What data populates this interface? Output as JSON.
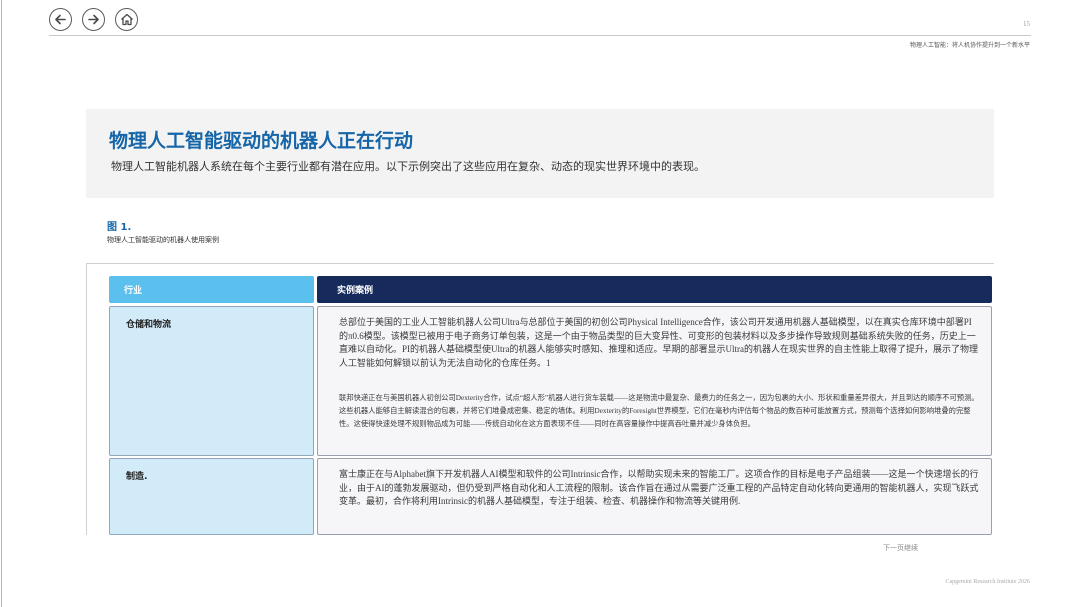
{
  "nav": {
    "back_icon": "arrow-left-icon",
    "forward_icon": "arrow-right-icon",
    "home_icon": "home-icon"
  },
  "header": {
    "page_number": "15",
    "doc_title": "物理人工智能：将人机协作提升到一个新水平"
  },
  "intro": {
    "title": "物理人工智能驱动的机器人正在行动",
    "text": "物理人工智能机器人系统在每个主要行业都有潜在应用。以下示例突出了这些应用在复杂、动态的现实世界环境中的表现。"
  },
  "figure": {
    "label": "图 1.",
    "caption": "物理人工智能驱动的机器人使用案例"
  },
  "table": {
    "col_industry": "行业",
    "col_cases": "实例案例",
    "rows": [
      {
        "industry": "仓储和物流",
        "paragraphs": [
          "总部位于美国的工业人工智能机器人公司Ultra与总部位于美国的初创公司Physical Intelligence合作，该公司开发通用机器人基础模型，以在真实仓库环境中部署PI的π0.6模型。该模型已被用于电子商务订单包装，这是一个由于物品类型的巨大变异性、可变形的包装材料以及多步操作导致规则基础系统失败的任务，历史上一直难以自动化。PI的机器人基础模型使Ultra的机器人能够实时感知、推理和适应。早期的部署显示Ultra的机器人在现实世界的自主性能上取得了提升，展示了物理人工智能如何解锁以前认为无法自动化的仓库任务。1",
          "联邦快递正在与美国机器人初创公司Dexterity合作，试点“超人形”机器人进行货车装载——这是物流中最复杂、最费力的任务之一，因为包裹的大小、形状和重量差异很大，并且到达的顺序不可预测。这些机器人能够自主解读混合的包裹，并将它们堆叠成密集、稳定的墙体。利用Dexterity的Foresight世界模型，它们在毫秒内评估每个物品的数百种可能放置方式，预测每个选择如何影响堆叠的完整性。这使得快速处理不规则物品成为可能——传统自动化在这方面表现不佳——同时在高容量操作中提高吞吐量并减少身体负担。"
        ]
      },
      {
        "industry": "制造.",
        "paragraphs": [
          "富士康正在与Alphabet旗下开发机器人AI模型和软件的公司Intrinsic合作，以帮助实现未来的智能工厂。这项合作的目标是电子产品组装——这是一个快速增长的行业，由于AI的蓬勃发展驱动，但仍受到严格自动化和人工流程的限制。该合作旨在通过从需要广泛重工程的产品特定自动化转向更通用的智能机器人，实现飞跃式变革。最初，合作将利用Intrinsic的机器人基础模型，专注于组装、检查、机器操作和物流等关键用例."
        ]
      }
    ]
  },
  "continue_note": "下一页继续",
  "footer": "Capgemini Research Institute 2026"
}
